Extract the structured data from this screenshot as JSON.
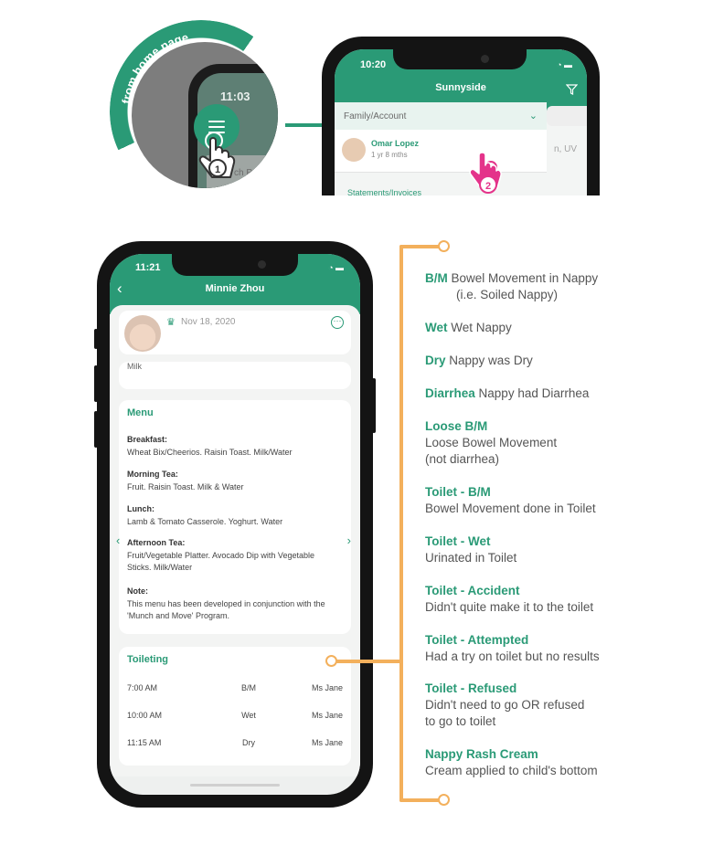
{
  "colors": {
    "brand": "#2a9a76",
    "accent_orange": "#f3b05c",
    "tap_pink": "#e4338a"
  },
  "zoom": {
    "arc_label": "from home page",
    "time": "11:03",
    "search_hint": "ch Pos",
    "step": "1"
  },
  "phone_top": {
    "time": "10:20",
    "title": "Sunnyside",
    "dropdown_label": "Family/Account",
    "child": {
      "name": "Omar Lopez",
      "age": "1 yr 8 mths"
    },
    "side_text": "n, UV",
    "statements_label": "Statements/Invoices",
    "step": "2"
  },
  "phone_main": {
    "time": "11:21",
    "title": "Minnie Zhou",
    "profile": {
      "date": "Nov 18, 2020"
    },
    "milk_text": "Milk",
    "menu": {
      "title": "Menu",
      "sections": [
        {
          "label": "Breakfast:",
          "text": "Wheat Bix/Cheerios. Raisin Toast. Milk/Water"
        },
        {
          "label": "Morning Tea:",
          "text": "Fruit. Raisin Toast. Milk & Water"
        },
        {
          "label": "Lunch:",
          "text": "Lamb & Tomato Casserole. Yoghurt. Water"
        },
        {
          "label": "Afternoon Tea:",
          "text": "Fruit/Vegetable Platter. Avocado Dip with Vegetable Sticks. Milk/Water"
        },
        {
          "label": "Note:",
          "text": "This menu has been developed in conjunction with the 'Munch and Move' Program."
        }
      ]
    },
    "toileting": {
      "title": "Toileting",
      "rows": [
        {
          "time": "7:00 AM",
          "type": "B/M",
          "by": "Ms Jane"
        },
        {
          "time": "10:00 AM",
          "type": "Wet",
          "by": "Ms Jane"
        },
        {
          "time": "11:15 AM",
          "type": "Dry",
          "by": "Ms Jane"
        }
      ]
    }
  },
  "legend": [
    {
      "code": "B/M",
      "desc": "Bowel Movement in Nappy",
      "desc2": "(i.e. Soiled Nappy)"
    },
    {
      "code": "Wet",
      "desc": "Wet Nappy"
    },
    {
      "code": "Dry",
      "desc": "Nappy was Dry"
    },
    {
      "code": "Diarrhea",
      "desc": "Nappy had Diarrhea"
    },
    {
      "code": "Loose B/M",
      "desc": "Loose Bowel Movement",
      "desc2": "(not diarrhea)"
    },
    {
      "code": "Toilet - B/M",
      "desc": "Bowel Movement done in Toilet"
    },
    {
      "code": "Toilet - Wet",
      "desc": "Urinated in Toilet"
    },
    {
      "code": "Toilet - Accident",
      "desc": "Didn't quite make it to the toilet"
    },
    {
      "code": "Toilet - Attempted",
      "desc": "Had a try on toilet but no results"
    },
    {
      "code": "Toilet - Refused",
      "desc": "Didn't need to go OR refused",
      "desc2": "to go to toilet"
    },
    {
      "code": "Nappy Rash Cream",
      "desc": "Cream applied to child's bottom"
    }
  ]
}
